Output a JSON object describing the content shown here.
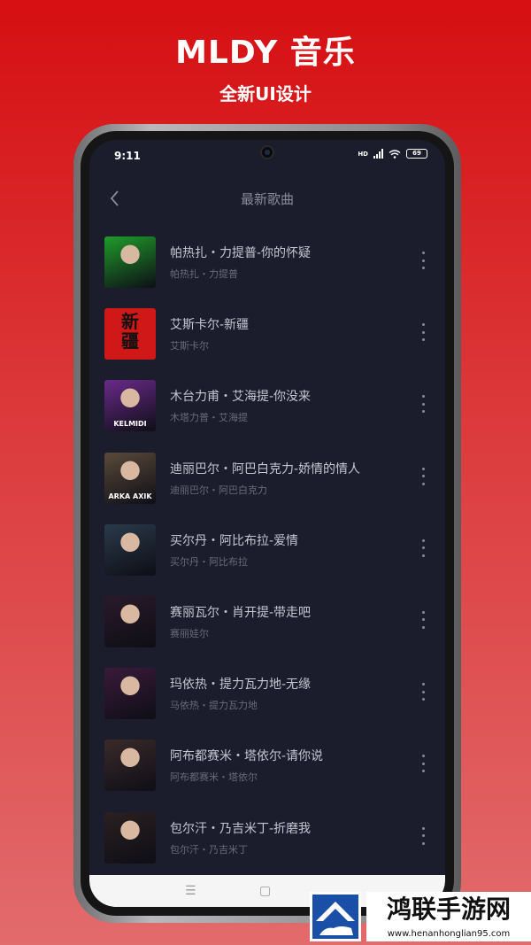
{
  "promo": {
    "title": "MLDY 音乐",
    "subtitle": "全新UI设计"
  },
  "status_bar": {
    "time": "9:11",
    "network": "HD",
    "battery": "69"
  },
  "nav": {
    "title": "最新歌曲"
  },
  "songs": [
    {
      "title": "帕热扎・力提普-你的怀疑",
      "artist": "帕热扎・力提普",
      "cover_color": "#1e9c2a"
    },
    {
      "title": "艾斯卡尔-新疆",
      "artist": "艾斯卡尔",
      "cover_text": "新\n疆",
      "cover_color": "#d01818"
    },
    {
      "title": "木台力甫・艾海提-你没来",
      "artist": "木塔力普・艾海提",
      "cover_text": "KELMIDI",
      "cover_color": "#6a2a8a"
    },
    {
      "title": "迪丽巴尔・阿巴白克力-娇情的情人",
      "artist": "迪丽巴尔・阿巴白克力",
      "cover_text": "ARKA AXIK",
      "cover_color": "#5a4a3a"
    },
    {
      "title": "买尔丹・阿比布拉-爱情",
      "artist": "买尔丹・阿比布拉",
      "cover_color": "#2a3a4a"
    },
    {
      "title": "赛丽瓦尔・肖开提-带走吧",
      "artist": "赛丽娃尔",
      "cover_color": "#2a1a2a"
    },
    {
      "title": "玛依热・提力瓦力地-无缘",
      "artist": "马依热・提力瓦力地",
      "cover_color": "#3a1a3a"
    },
    {
      "title": "阿布都赛米・塔依尔-请你说",
      "artist": "阿布都赛米・塔依尔",
      "cover_color": "#3a2a2a"
    },
    {
      "title": "包尔汗・乃吉米丁-折磨我",
      "artist": "包尔汗・乃吉米丁",
      "cover_color": "#2a2020"
    }
  ],
  "watermark": {
    "brand": "鸿联手游网",
    "url": "www.henanhonglian95.com"
  },
  "colors": {
    "background_top": "#d60f12",
    "screen_bg": "#1b1c2c",
    "title_text": "#c6c6d2",
    "subtitle_text": "#6a6a7a"
  }
}
